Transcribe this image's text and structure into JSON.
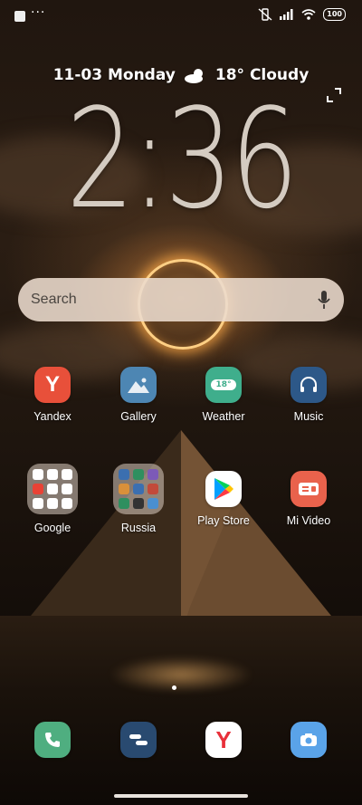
{
  "status": {
    "dots": "···",
    "battery": "100"
  },
  "widget": {
    "date": "11-03 Monday",
    "weather": "18° Cloudy",
    "time": "2:36"
  },
  "search": {
    "placeholder": "Search"
  },
  "apps_row1": [
    {
      "label": "Yandex",
      "icon": "yandex-icon",
      "color": "#e8503a"
    },
    {
      "label": "Gallery",
      "icon": "gallery-icon",
      "color": "#4d86b3"
    },
    {
      "label": "Weather",
      "icon": "weather-icon",
      "color": "#3fae8c",
      "badge": "18°"
    },
    {
      "label": "Music",
      "icon": "headphones-icon",
      "color": "#2d5888"
    }
  ],
  "apps_row2": [
    {
      "label": "Google",
      "icon": "folder-icon"
    },
    {
      "label": "Russia",
      "icon": "folder-icon"
    },
    {
      "label": "Play Store",
      "icon": "play-store-icon",
      "color": "#ffffff"
    },
    {
      "label": "Mi Video",
      "icon": "video-icon",
      "color": "#e9624c"
    }
  ],
  "dock": [
    {
      "icon": "phone-icon",
      "color": "#4fae80"
    },
    {
      "icon": "messages-icon",
      "color": "#294a70"
    },
    {
      "icon": "yandex-browser-icon",
      "color": "#ffffff"
    },
    {
      "icon": "camera-icon",
      "color": "#5aa3e8"
    }
  ]
}
